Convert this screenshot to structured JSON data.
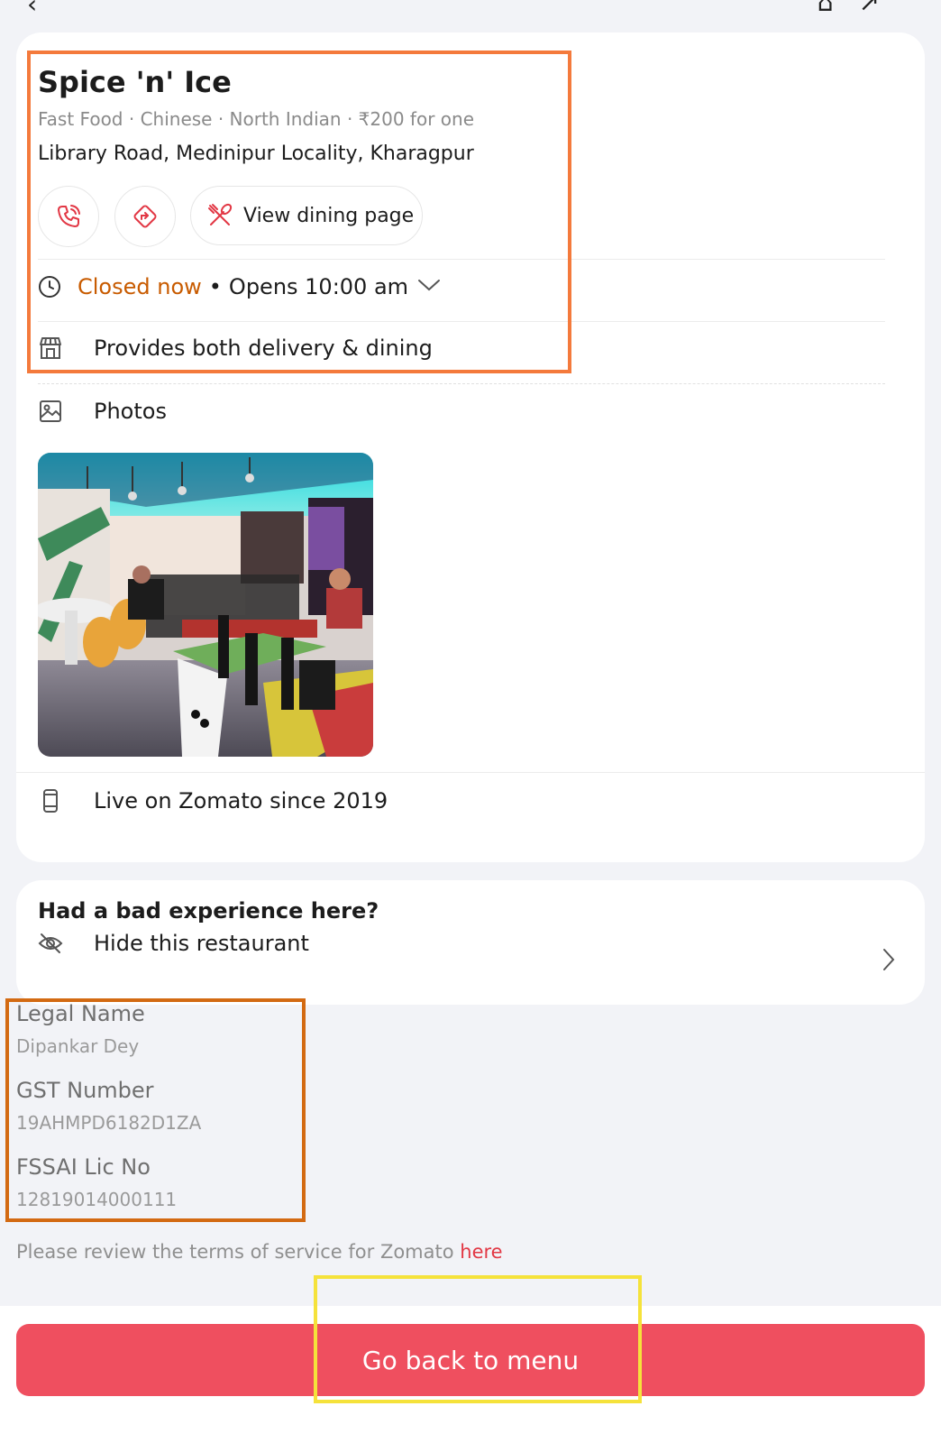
{
  "restaurant": {
    "name": "Spice 'n' Ice",
    "cuisine": "Fast Food · Chinese · North Indian · ₹200 for one",
    "address": "Library Road, Medinipur Locality, Kharagpur"
  },
  "actions": {
    "dining_label": "View dining page"
  },
  "hours": {
    "status": "Closed now",
    "separator": "•",
    "opens": "Opens 10:00 am"
  },
  "service": {
    "label": "Provides both delivery & dining"
  },
  "photos": {
    "label": "Photos"
  },
  "live": {
    "label": "Live on Zomato since 2019"
  },
  "bad_experience": {
    "title": "Had a bad experience here?",
    "hide_label": "Hide this restaurant"
  },
  "legal": {
    "legal_name_label": "Legal Name",
    "legal_name_value": "Dipankar Dey",
    "gst_label": "GST Number",
    "gst_value": "19AHMPD6182D1ZA",
    "fssai_label": "FSSAI Lic No",
    "fssai_value": "12819014000111"
  },
  "terms": {
    "text": "Please review the terms of service for Zomato ",
    "link": "here"
  },
  "cta": {
    "label": "Go back to menu"
  },
  "colors": {
    "accent": "#ef4f5f",
    "closed": "#c85b00",
    "link": "#e23744",
    "highlight_orange": "#f47a3c",
    "highlight_brown": "#d36a12",
    "highlight_yellow": "#f5e23b"
  },
  "icons": [
    "back-icon",
    "bookmark-icon",
    "share-icon",
    "phone-icon",
    "directions-icon",
    "fork-spoon-icon",
    "clock-icon",
    "chevron-down-icon",
    "store-icon",
    "photo-icon",
    "mobile-icon",
    "eye-off-icon",
    "chevron-right-icon"
  ]
}
